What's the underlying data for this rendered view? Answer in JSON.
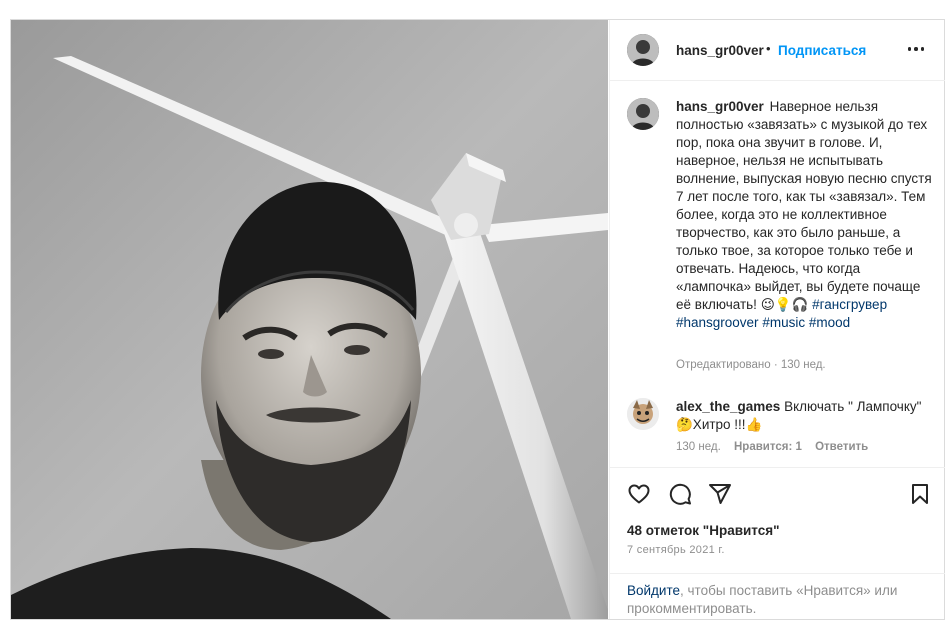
{
  "post": {
    "photo_alt": "",
    "header": {
      "username": "hans_gr00ver",
      "separator": "•",
      "follow_label": "Подписаться"
    },
    "caption": {
      "username": "hans_gr00ver",
      "text": "Наверное нельзя полностью «завязать» с музыкой до тех пор, пока она звучит в голове. И, наверное, нельзя не испытывать волнение, выпуская новую песню спустя 7 лет после того, как ты «завязал». Тем более, когда это не коллективное творчество, как это было раньше, а только твое, за которое только тебе и отвечать. Надеюсь, что когда «лампочка» выйдет, вы будете почаще её включать!",
      "emoji": "😉💡🎧",
      "hashtags": [
        "#гансгрувер",
        "#hansgroover",
        "#music",
        "#mood"
      ],
      "meta": "Отредактировано · 130 нед."
    },
    "comment": {
      "username": "alex_the_games",
      "text": "Включать \" Лампочку\" 🤔Хитро !!!👍",
      "age": "130 нед.",
      "likes": "Нравится: 1",
      "reply_label": "Ответить"
    },
    "likes_count": "48 отметок \"Нравится\"",
    "date": "7 сентябрь 2021 г.",
    "login_prompt": {
      "link": "Войдите",
      "rest": ", чтобы поставить «Нравится» или прокомментировать."
    }
  }
}
